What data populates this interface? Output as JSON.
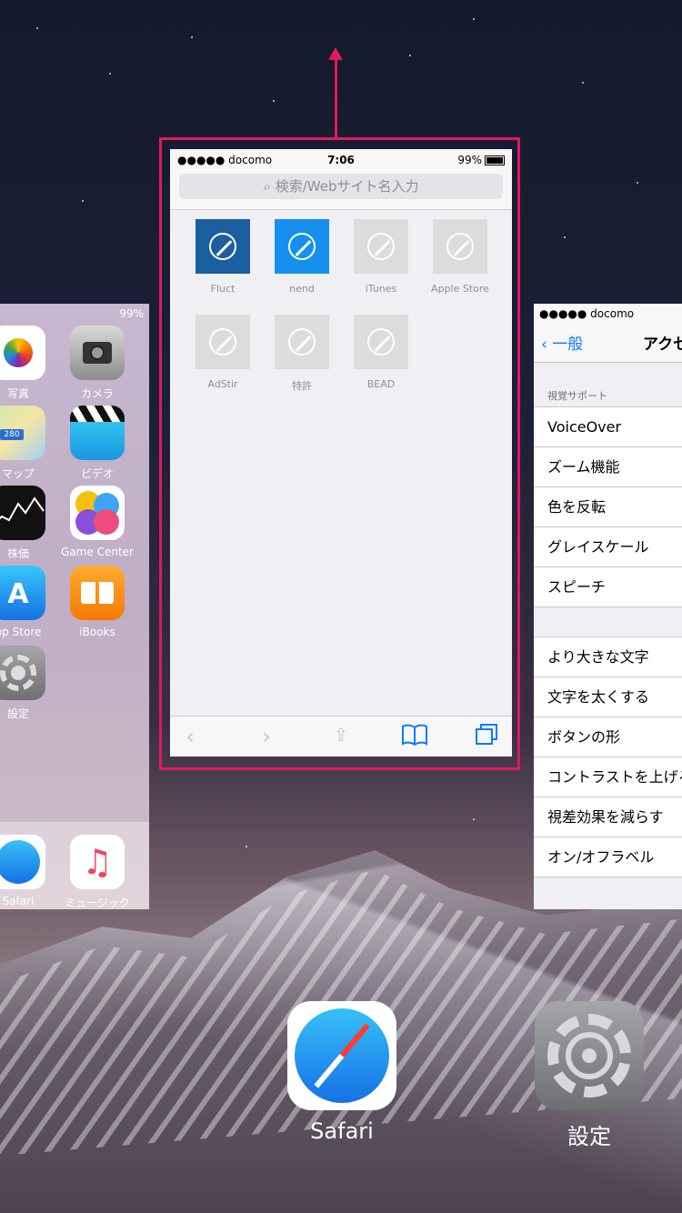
{
  "left_card": {
    "status": "99%",
    "apps": [
      {
        "label": "写真"
      },
      {
        "label": "カメラ"
      },
      {
        "label": "マップ"
      },
      {
        "label": "ビデオ"
      },
      {
        "label": "株価"
      },
      {
        "label": "Game Center"
      },
      {
        "label": "pp Store"
      },
      {
        "label": "iBooks"
      },
      {
        "label": "設定"
      }
    ],
    "dock": [
      {
        "label": "Safari"
      },
      {
        "label": "ミュージック"
      }
    ]
  },
  "safari_card": {
    "carrier": "●●●●● docomo",
    "time": "7:06",
    "battery": "99%",
    "search_placeholder": "検索/Webサイト名入力",
    "favorites": [
      {
        "label": "Fluct",
        "color": "#1c5fa0"
      },
      {
        "label": "nend",
        "color": "#1590ef"
      },
      {
        "label": "iTunes",
        "color": "#dcdcdc"
      },
      {
        "label": "Apple Store",
        "color": "#dcdcdc"
      },
      {
        "label": "AdStir",
        "color": "#dcdcdc"
      },
      {
        "label": "特許",
        "color": "#dcdcdc"
      },
      {
        "label": "BEAD",
        "color": "#dcdcdc"
      }
    ]
  },
  "settings_card": {
    "carrier": "●●●●● docomo",
    "back": "一般",
    "title": "アクセ",
    "section1": "視覚サポート",
    "group1": [
      "VoiceOver",
      "ズーム機能",
      "色を反転",
      "グレイスケール",
      "スピーチ"
    ],
    "group2": [
      "より大きな文字",
      "文字を太くする",
      "ボタンの形",
      "コントラストを上げる",
      "視差効果を減らす",
      "オン/オフラベル"
    ]
  },
  "bottom_labels": {
    "safari": "Safari",
    "settings": "設定"
  },
  "colors": {
    "accent": "#e0185c",
    "ios_blue": "#0a7aff"
  }
}
